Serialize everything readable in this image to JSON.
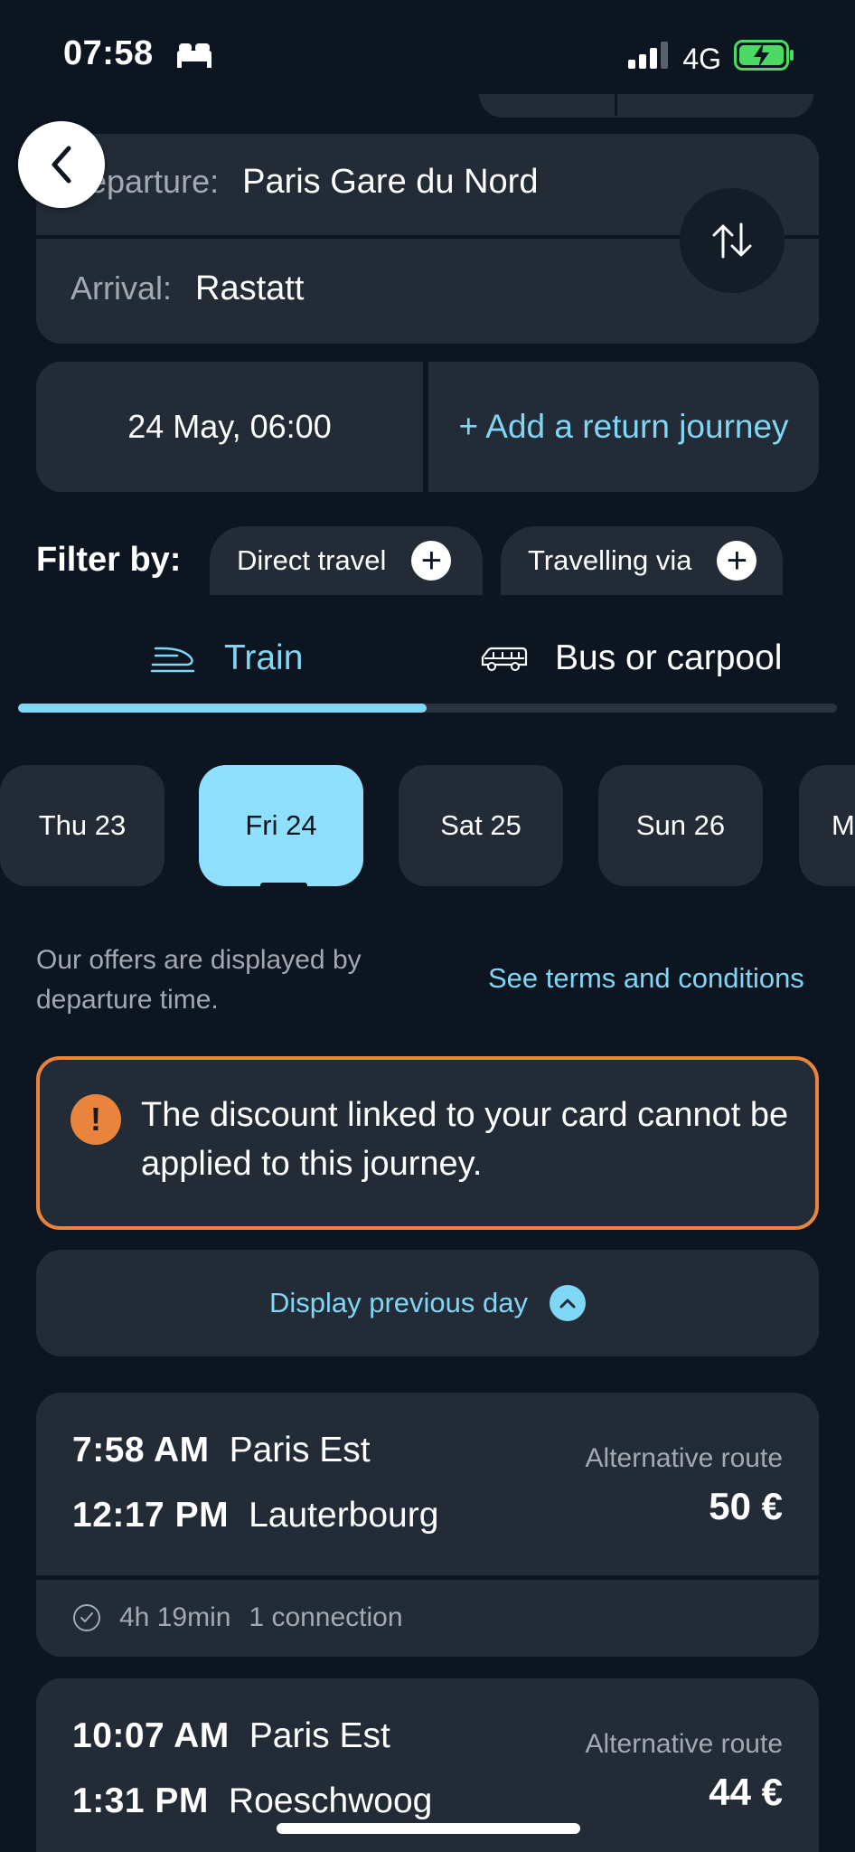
{
  "status_bar": {
    "time": "07:58",
    "network": "4G",
    "sleep_icon": "bed-icon",
    "signal_icon": "signal-bars-icon",
    "battery_icon": "battery-charging-icon"
  },
  "search": {
    "departure_label": "Departure:",
    "departure_label_visible": "eparture:",
    "departure_value": "Paris Gare du Nord",
    "arrival_label": "Arrival:",
    "arrival_value": "Rastatt",
    "date": "24 May, 06:00",
    "return_label": "+ Add a return journey"
  },
  "filters": {
    "label": "Filter by:",
    "chips": [
      {
        "label": "Direct travel"
      },
      {
        "label": "Travelling via"
      }
    ]
  },
  "tabs": [
    {
      "label": "Train",
      "active": true
    },
    {
      "label": "Bus or carpool",
      "active": false
    }
  ],
  "days": [
    {
      "label": "Thu 23",
      "active": false
    },
    {
      "label": "Fri 24",
      "active": true
    },
    {
      "label": "Sat 25",
      "active": false
    },
    {
      "label": "Sun 26",
      "active": false
    },
    {
      "label": "M",
      "active": false
    }
  ],
  "info": {
    "offers_note": "Our offers are displayed by departure time.",
    "terms_link": "See terms and conditions"
  },
  "warning": {
    "icon": "!",
    "text": "The discount linked to your card cannot be applied to this journey."
  },
  "previous_day_label": "Display previous day",
  "journeys": [
    {
      "depart_time": "7:58 AM",
      "depart_station": "Paris Est",
      "arrive_time": "12:17 PM",
      "arrive_station": "Lauterbourg",
      "route_type": "Alternative route",
      "price": "50 €",
      "duration": "4h 19min",
      "connections": "1 connection"
    },
    {
      "depart_time": "10:07 AM",
      "depart_station": "Paris Est",
      "arrive_time": "1:31 PM",
      "arrive_station": "Roeschwoog",
      "route_type": "Alternative route",
      "price": "44 €"
    }
  ],
  "colors": {
    "background": "#0c1520",
    "card": "#232b36",
    "accent": "#7fd6f5",
    "active_day": "#8fe0ff",
    "warning": "#e8843c",
    "muted_text": "#a3a9b2"
  }
}
